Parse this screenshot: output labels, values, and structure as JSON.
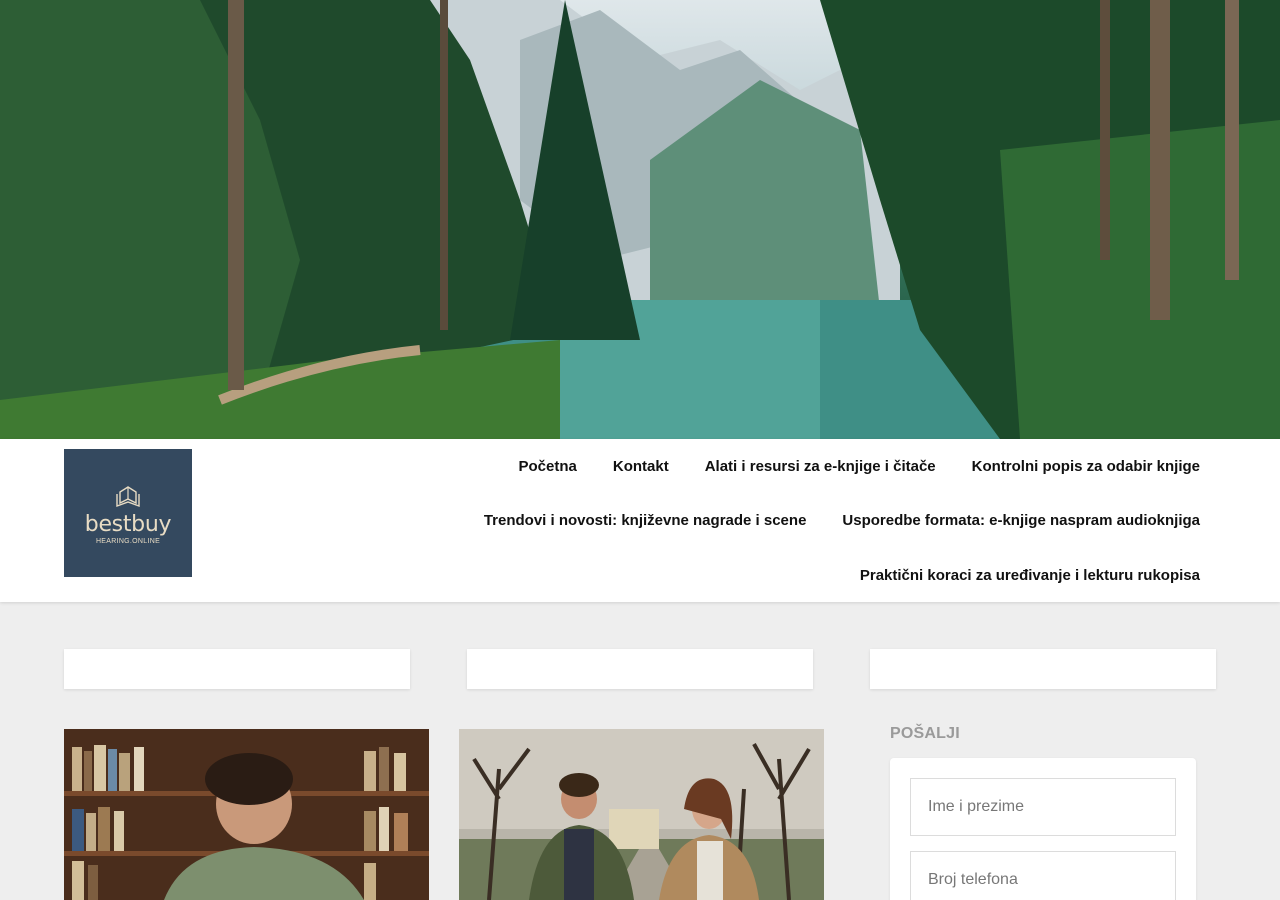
{
  "logo": {
    "name": "bestbuy",
    "subtitle": "HEARING.ONLINE"
  },
  "nav": {
    "row1": [
      "Početna",
      "Kontakt",
      "Alati i resursi za e-knjige i čitače",
      "Kontrolni popis za odabir knjige"
    ],
    "row2": [
      "Trendovi i novosti: književne nagrade i scene",
      "Usporedbe formata: e-knjige naspram audioknjiga"
    ],
    "row3": [
      "Praktični koraci za uređivanje i lekturu rukopisa"
    ]
  },
  "sidebar": {
    "widget_title": "POŠALJI",
    "name_placeholder": "Ime i prezime",
    "phone_placeholder": "Broj telefona"
  },
  "colors": {
    "logo_bg": "#34495f",
    "logo_text": "#e8dcc4",
    "page_bg": "#eeeeee",
    "widget_title": "#9a9a9a"
  }
}
